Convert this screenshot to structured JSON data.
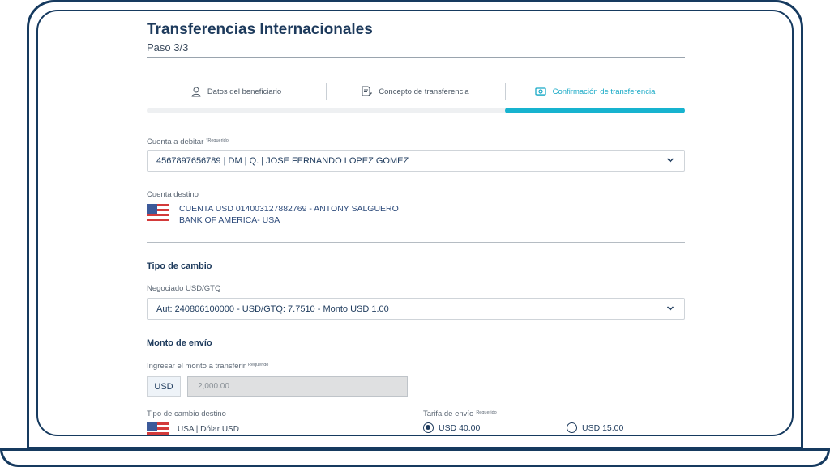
{
  "page": {
    "title": "Transferencias Internacionales",
    "step": "Paso 3/3"
  },
  "stepper": {
    "steps": [
      {
        "label": "Datos del beneficiario",
        "icon": "user-icon"
      },
      {
        "label": "Concepto de transferencia",
        "icon": "document-edit-icon"
      },
      {
        "label": "Confirmación de transferencia",
        "icon": "money-icon"
      }
    ],
    "active_step": 3,
    "accent_color": "#17b3cf"
  },
  "debit_account": {
    "label": "Cuenta a debitar",
    "required": "*Requerido",
    "value": "4567897656789 | DM | Q. | JOSE FERNANDO LOPEZ GOMEZ"
  },
  "destination": {
    "label": "Cuenta destino",
    "line1": "CUENTA USD 014003127882769 - ANTONY  SALGUERO",
    "line2": "BANK OF AMERICA- USA",
    "flag": "usa-flag-icon"
  },
  "exchange": {
    "title": "Tipo de cambio",
    "label": "Negociado USD/GTQ",
    "value": "Aut: 240806100000 - USD/GTQ: 7.7510 - Monto USD 1.00"
  },
  "amount": {
    "title": "Monto de envío",
    "label": "Ingresar el monto a transferir",
    "required": "Requerido",
    "currency": "USD",
    "value": "2,000.00"
  },
  "dest_rate": {
    "label": "Tipo de cambio destino",
    "value": "USA | Dólar USD"
  },
  "fee": {
    "label": "Tarifa de envío",
    "required": "Requerido",
    "options": [
      {
        "label": "USD 40.00",
        "checked": true
      },
      {
        "label": "USD 15.00",
        "checked": false
      }
    ]
  }
}
